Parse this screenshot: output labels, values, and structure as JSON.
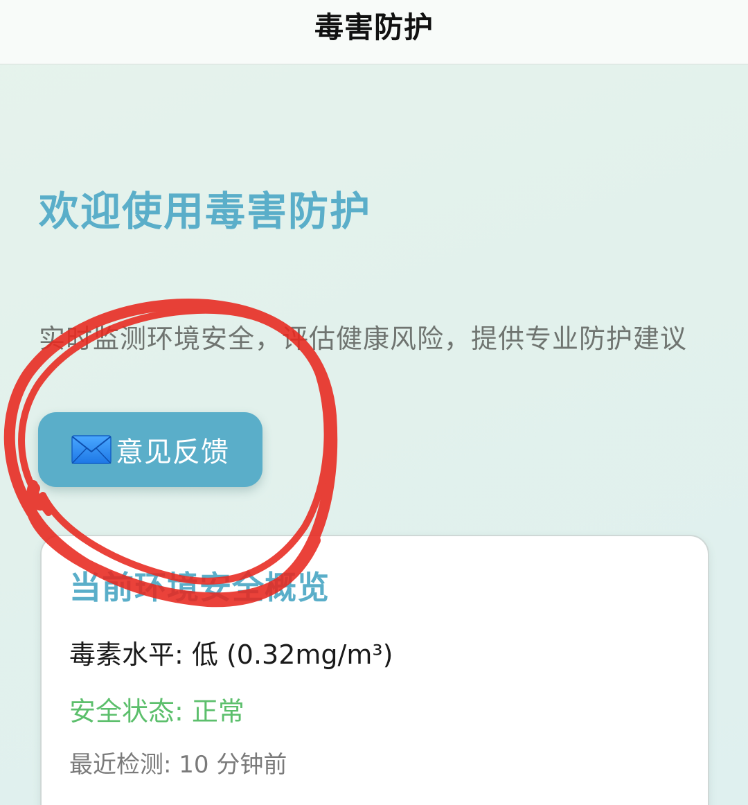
{
  "nav": {
    "title": "毒害防护"
  },
  "hero": {
    "title": "欢迎使用毒害防护",
    "subtitle": "实时监测环境安全，评估健康风险，提供专业防护建议"
  },
  "feedback_button": {
    "icon": "envelope-icon",
    "label": "意见反馈"
  },
  "overview_card": {
    "title": "当前环境安全概览",
    "toxin_level": "毒素水平: 低 (0.32mg/m³)",
    "safety_status": "安全状态: 正常",
    "last_check": "最近检测: 10 分钟前"
  },
  "colors": {
    "accent": "#5aaec9",
    "safe_green": "#5cbf6c",
    "annotation_red": "#e8281f"
  }
}
